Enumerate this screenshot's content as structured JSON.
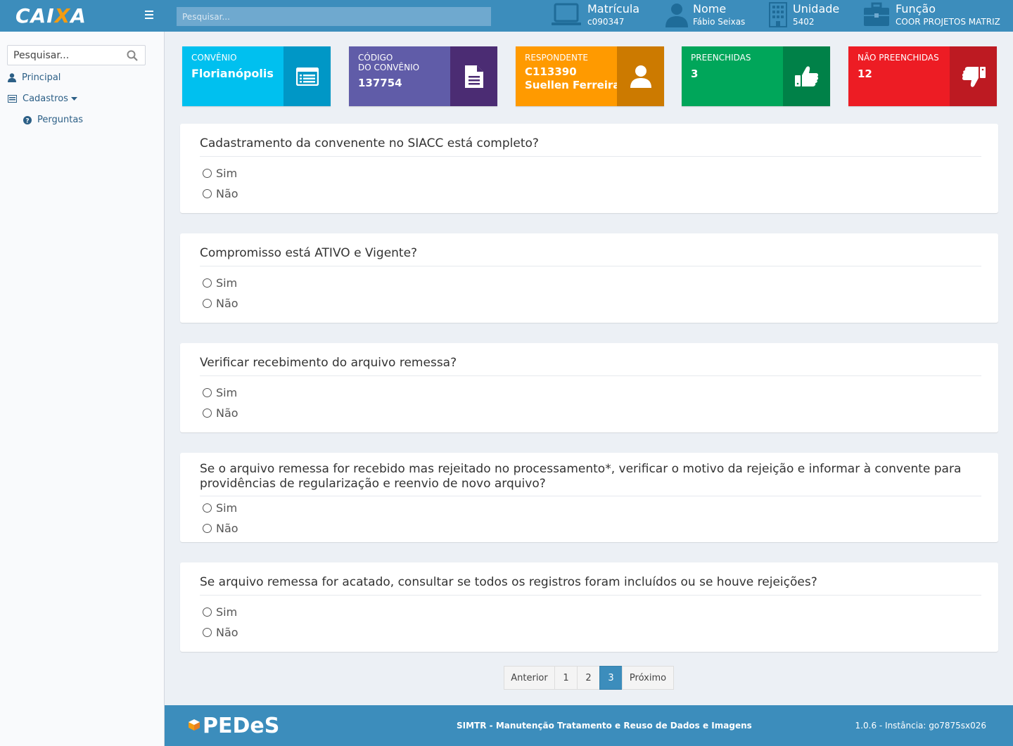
{
  "header": {
    "logo_text_a": "CAI",
    "logo_text_b": "X",
    "logo_text_c": "A",
    "search_placeholder": "Pesquisar...",
    "user": {
      "matricula_label": "Matrícula",
      "matricula_value": "c090347",
      "nome_label": "Nome",
      "nome_value": "Fábio Seixas",
      "unidade_label": "Unidade",
      "unidade_value": "5402",
      "funcao_label": "Função",
      "funcao_value": "COOR PROJETOS MATRIZ"
    }
  },
  "sidebar": {
    "search_placeholder": "Pesquisar...",
    "items": [
      {
        "label": "Principal",
        "icon": "user-icon"
      },
      {
        "label": "Cadastros",
        "icon": "list-icon"
      },
      {
        "label": "Perguntas",
        "icon": "question-circle-icon"
      }
    ]
  },
  "info_boxes": [
    {
      "label": "CONVÊNIO",
      "value": "Florianópolis",
      "color": "#00c0ef",
      "icon_bg": "#0097c6",
      "icon": "list-alt-icon"
    },
    {
      "label1": "CÓDIGO",
      "label2": "DO CONVÊNIO",
      "value": "137754",
      "color": "#605ca8",
      "icon_bg": "#4b2c73",
      "icon": "file-icon"
    },
    {
      "label": "RESPONDENTE",
      "value1": "C113390",
      "value2": "Suellen Ferreira",
      "color": "#ff9a00",
      "icon_bg": "#cc7a00",
      "icon": "user-icon"
    },
    {
      "label": "PREENCHIDAS",
      "value": "3",
      "color": "#00a65a",
      "icon_bg": "#008148",
      "icon": "thumbs-up-icon"
    },
    {
      "label": "NÃO PREENCHIDAS",
      "value": "12",
      "color": "#ed1c24",
      "icon_bg": "#bd1a22",
      "icon": "thumbs-down-icon"
    }
  ],
  "questions": [
    {
      "text": "Cadastramento da convenente no SIACC está completo?",
      "opt_yes": "Sim",
      "opt_no": "Não"
    },
    {
      "text": "Compromisso está ATIVO e Vigente?",
      "opt_yes": "Sim",
      "opt_no": "Não"
    },
    {
      "text": "Verificar recebimento do arquivo remessa?",
      "opt_yes": "Sim",
      "opt_no": "Não"
    },
    {
      "text": "Se o arquivo remessa for recebido mas rejeitado no processamento*, verificar o motivo da rejeição e informar à convente para providências de regularização e reenvio de novo arquivo?",
      "opt_yes": "Sim",
      "opt_no": "Não"
    },
    {
      "text": "Se arquivo remessa for acatado, consultar se todos os registros foram incluídos ou se houve rejeições?",
      "opt_yes": "Sim",
      "opt_no": "Não"
    }
  ],
  "pagination": {
    "prev": "Anterior",
    "p1": "1",
    "p2": "2",
    "p3": "3",
    "next": "Próximo",
    "active": "3"
  },
  "footer": {
    "logo": "PEDeS",
    "system_bold": "SIMTR",
    "system_rest": " - Manutenção Tratamento e Reuso de Dados e Imagens",
    "version": "1.0.6 - Instância: go7875sx026"
  }
}
